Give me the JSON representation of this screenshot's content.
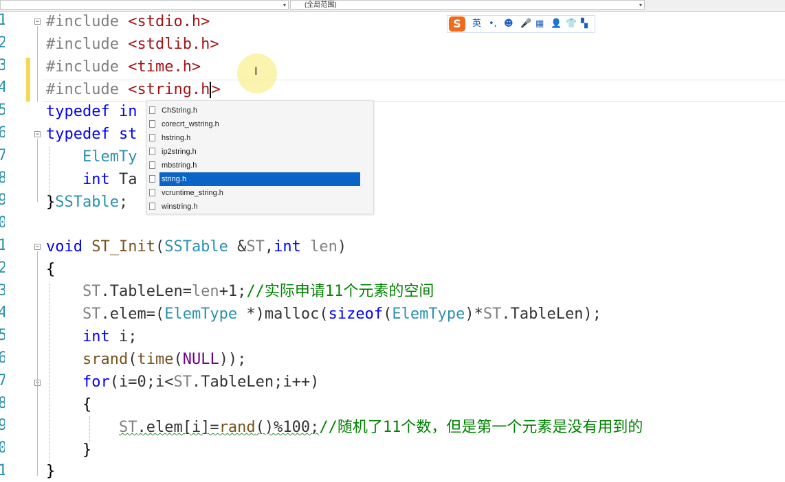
{
  "toolbar": {
    "left_combo_value": "",
    "scope_combo_value": "(全局范围)"
  },
  "gutter": {
    "line_number_tails": [
      "1",
      "2",
      "3",
      "4",
      "5",
      "6",
      "7",
      "8",
      "9",
      "0",
      "1",
      "2",
      "3",
      "4",
      "5",
      "6",
      "7",
      "8",
      "9",
      "0",
      "1"
    ]
  },
  "code": {
    "l1": {
      "directive": "#include",
      "header": "<stdio.h>"
    },
    "l2": {
      "directive": "#include",
      "header": "<stdlib.h>"
    },
    "l3": {
      "directive": "#include",
      "header": "<time.h>"
    },
    "l4": {
      "directive": "#include",
      "header_before_cursor": "<string.h",
      "header_after_cursor": ">"
    },
    "l5": {
      "kw": "typedef",
      "rest": "in"
    },
    "l6": {
      "kw": "typedef",
      "rest": "st"
    },
    "l7": {
      "type": "ElemTy"
    },
    "l8": {
      "kw": "int",
      "rest": "Ta"
    },
    "l9": {
      "brace": "}",
      "type": "SSTable",
      "semi": ";"
    },
    "l11": {
      "kw_void": "void",
      "fn": "ST_Init",
      "open": "(",
      "type": "SSTable",
      "amp": " &",
      "param": "ST",
      "comma": ",",
      "kw_int": "int",
      "param2": "len",
      "close": ")"
    },
    "l12": {
      "brace": "{"
    },
    "l13": {
      "obj": "ST",
      "member": ".TableLen=",
      "param": "len",
      "rest": "+1;",
      "comment": "//实际申请11个元素的空间"
    },
    "l14": {
      "obj": "ST",
      "member": ".elem=(",
      "type1": "ElemType",
      "mid": " *)malloc(",
      "kw": "sizeof",
      "open": "(",
      "type2": "ElemType",
      "close": ")*",
      "obj2": "ST",
      "end": ".TableLen);"
    },
    "l15": {
      "kw": "int",
      "rest": " i;"
    },
    "l16": {
      "fn": "srand",
      "open": "(",
      "fn2": "time",
      "open2": "(",
      "macro": "NULL",
      "end": "));"
    },
    "l17": {
      "kw": "for",
      "a": "(i=0;i<",
      "obj": "ST",
      "b": ".TableLen;i++)"
    },
    "l18": {
      "brace": "{"
    },
    "l19": {
      "obj": "ST",
      "a": ".elem[i]=",
      "fn": "rand",
      "b": "()%100;",
      "comment": "//随机了11个数，但是第一个元素是没有用到的"
    },
    "l20": {
      "brace": "}"
    },
    "l21": {
      "brace": "}"
    }
  },
  "autocomplete": {
    "items": [
      "ChString.h",
      "corecrt_wstring.h",
      "hstring.h",
      "ip2string.h",
      "mbstring.h",
      "string.h",
      "vcruntime_string.h",
      "winstring.h"
    ],
    "selected_index": 5
  },
  "ime_bar": {
    "logo": "S",
    "mode": "英",
    "punct": "•,",
    "emoji_icon": "smiley-icon",
    "mic_icon": "microphone-icon",
    "keyboard_icon": "keyboard-icon",
    "user_icon": "user-icon",
    "skin_icon": "shirt-icon",
    "apps_icon": "grid-icon"
  }
}
